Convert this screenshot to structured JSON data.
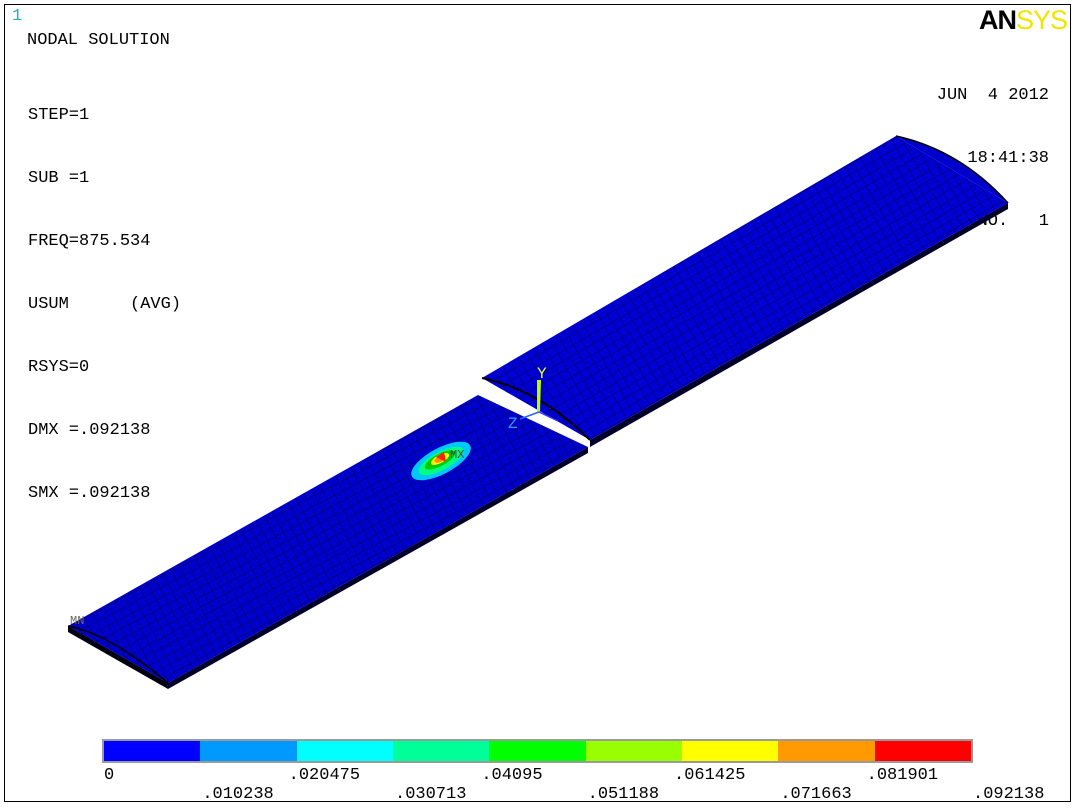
{
  "window_number": "1",
  "logo": {
    "an": "AN",
    "sys": "SYS",
    "an_color": "#000000",
    "sys_color": "#f3e400"
  },
  "plot_title": "NODAL SOLUTION",
  "info": [
    "STEP=1",
    "SUB =1",
    "FREQ=875.534",
    "USUM      (AVG)",
    "RSYS=0",
    "DMX =.092138",
    "SMX =.092138"
  ],
  "datetime": {
    "date": "JUN  4 2012",
    "time": "18:41:38",
    "plot_no": "PLOT NO.   1"
  },
  "model": {
    "triad": {
      "x_label": "Y",
      "z_label": "Z"
    },
    "min_label": "MN",
    "max_label": "MX",
    "mesh_color": "#0000cc",
    "hotspot_colors": [
      "#00ccff",
      "#00ff80",
      "#00cc00",
      "#ffff00",
      "#ff8800",
      "#ff0000"
    ]
  },
  "legend": {
    "colors": [
      "#0000ff",
      "#0099ff",
      "#00ffff",
      "#00ff99",
      "#00ff00",
      "#99ff00",
      "#ffff00",
      "#ff9900",
      "#ff0000"
    ],
    "upper_labels": [
      "0",
      ".020475",
      ".04095",
      ".061425",
      ".081901"
    ],
    "lower_labels": [
      ".010238",
      ".030713",
      ".051188",
      ".071663",
      ".092138"
    ]
  }
}
